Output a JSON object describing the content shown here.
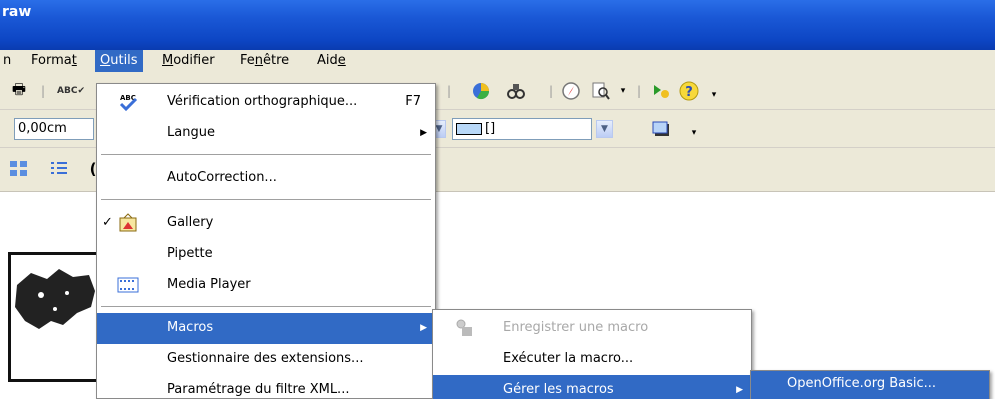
{
  "title": "raw",
  "menubar": {
    "items": [
      "n",
      "Format",
      "Outils",
      "Modifier",
      "Fenêtre",
      "Aide"
    ]
  },
  "toolbar2": {
    "position_value": "0,00cm",
    "line_style_value": "[]"
  },
  "outils_menu": {
    "items": [
      {
        "label": "Vérification orthographique...",
        "accel": "F7",
        "icon": "spellcheck-icon"
      },
      {
        "label": "Langue",
        "submenu": true
      },
      {
        "label": "AutoCorrection..."
      },
      {
        "label": "Gallery",
        "checked": true,
        "icon": "gallery-icon"
      },
      {
        "label": "Pipette"
      },
      {
        "label": "Media Player",
        "icon": "media-player-icon"
      },
      {
        "label": "Macros",
        "submenu": true,
        "highlighted": true
      },
      {
        "label": "Gestionnaire des extensions..."
      },
      {
        "label": "Paramétrage du filtre XML..."
      }
    ]
  },
  "macros_menu": {
    "items": [
      {
        "label": "Enregistrer une macro",
        "disabled": true,
        "icon": "record-macro-icon"
      },
      {
        "label": "Exécuter la macro..."
      },
      {
        "label": "Gérer les macros",
        "submenu": true,
        "highlighted": true
      }
    ]
  },
  "gerer_menu": {
    "items": [
      {
        "label": "OpenOffice.org Basic...",
        "highlighted": true
      }
    ]
  },
  "colors": {
    "titlebar": "#0d46c4",
    "highlight": "#316ac5",
    "chrome": "#ece9d8"
  }
}
